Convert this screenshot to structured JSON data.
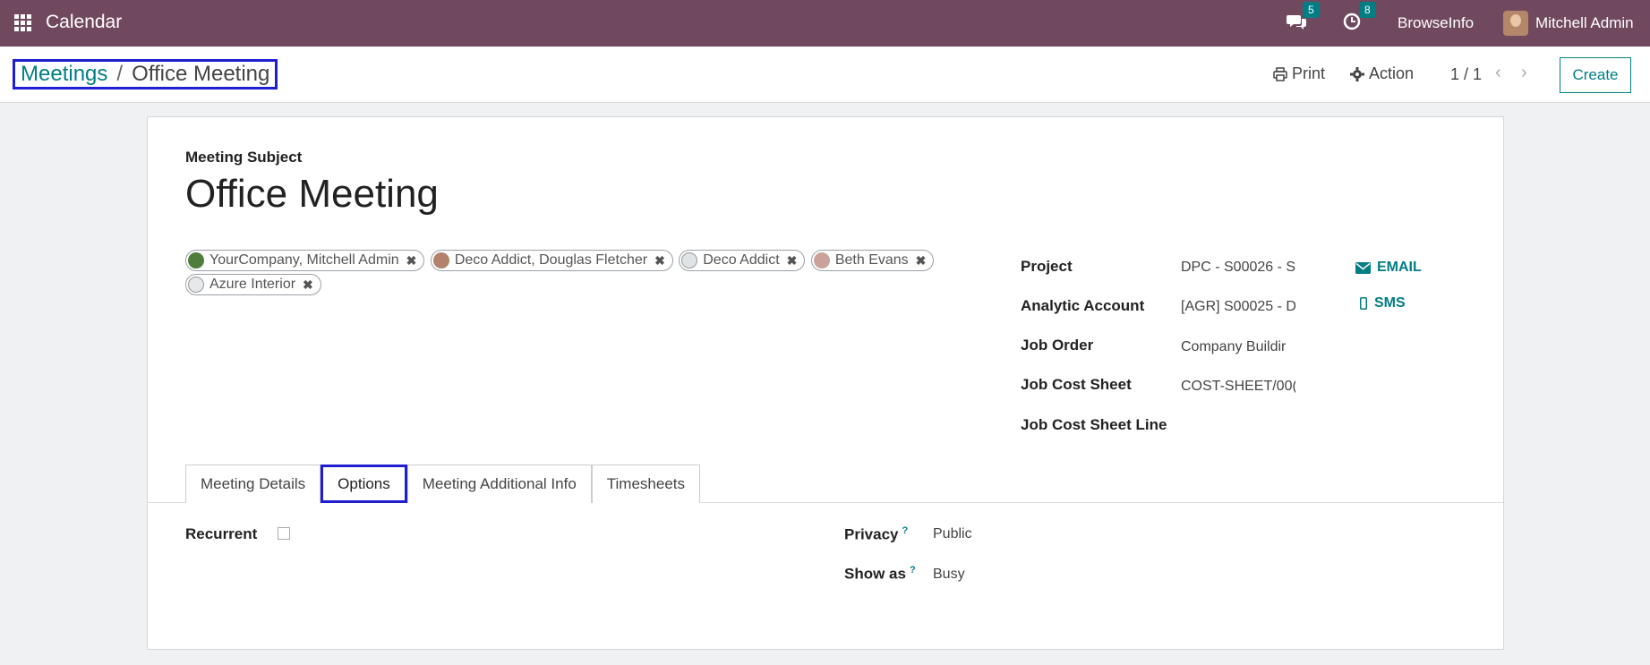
{
  "navbar": {
    "app_title": "Calendar",
    "messages_count": "5",
    "activities_count": "8",
    "company": "BrowseInfo",
    "user": "Mitchell Admin",
    "color": "#71495f"
  },
  "breadcrumb": {
    "parent": "Meetings",
    "separator": "/",
    "current": "Office Meeting"
  },
  "control": {
    "print_label": "Print",
    "action_label": "Action",
    "pager": "1 / 1",
    "create_label": "Create"
  },
  "form": {
    "subject_label": "Meeting Subject",
    "subject": "Office Meeting",
    "attendees": [
      {
        "name": "YourCompany, Mitchell Admin",
        "avatar_color": "#4f7d3a"
      },
      {
        "name": "Deco Addict, Douglas Fletcher",
        "avatar_color": "#b3826a"
      },
      {
        "name": "Deco Addict",
        "avatar_color": "#dfe4e6"
      },
      {
        "name": "Beth Evans",
        "avatar_color": "#c9a39b"
      },
      {
        "name": "Azure Interior",
        "avatar_color": "#e6e8ea"
      }
    ],
    "fields": {
      "project_label": "Project",
      "project_value": "DPC - S00026 - S",
      "analytic_label": "Analytic Account",
      "analytic_value": "[AGR] S00025 - D",
      "job_order_label": "Job Order",
      "job_order_value": "Company Buildir",
      "job_cost_sheet_label": "Job Cost Sheet",
      "job_cost_sheet_value": "COST-SHEET/00(",
      "job_cost_sheet_line_label": "Job Cost Sheet Line"
    },
    "email_label": "EMAIL",
    "sms_label": "SMS"
  },
  "tabs": [
    {
      "label": "Meeting Details",
      "active": false
    },
    {
      "label": "Options",
      "active": true
    },
    {
      "label": "Meeting Additional Info",
      "active": false
    },
    {
      "label": "Timesheets",
      "active": false
    }
  ],
  "options": {
    "recurrent_label": "Recurrent",
    "recurrent_checked": false,
    "privacy_label": "Privacy",
    "privacy_value": "Public",
    "show_as_label": "Show as",
    "show_as_value": "Busy",
    "help_mark": "?"
  }
}
